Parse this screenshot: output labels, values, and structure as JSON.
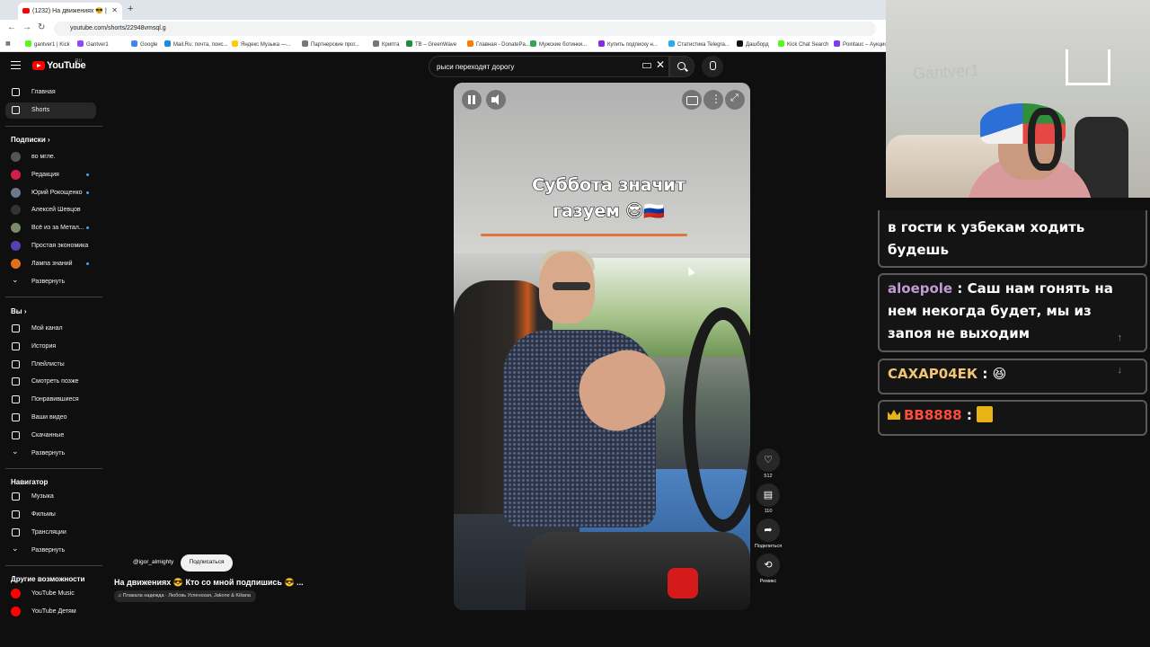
{
  "browser": {
    "tab_title": "(1232) На движениях 😎 |",
    "url": "youtube.com/shorts/22948vmsql.g",
    "bookmarks": [
      {
        "label": "gantver1 | Kick",
        "color": "#53fc18"
      },
      {
        "label": "Gantver1",
        "color": "#9146ff"
      },
      {
        "label": "Google",
        "color": "#4285f4"
      },
      {
        "label": "Mail.Ru: почта, поис...",
        "color": "#168de2"
      },
      {
        "label": "Яндекс Музыка —...",
        "color": "#ffcc00"
      },
      {
        "label": "Партнерские прог...",
        "color": "#777777"
      },
      {
        "label": "Крипта",
        "color": "#777777"
      },
      {
        "label": "TB – GreenWave",
        "color": "#1e8e3e"
      },
      {
        "label": "Главная - DonatePa...",
        "color": "#ff7a00"
      },
      {
        "label": "Мужские ботинки...",
        "color": "#32a852"
      },
      {
        "label": "Купить подписку н...",
        "color": "#8a2be2"
      },
      {
        "label": "Статистика Telegra...",
        "color": "#2aabee"
      },
      {
        "label": "Дашборд",
        "color": "#111111"
      },
      {
        "label": "Kick Chat Search",
        "color": "#53fc18"
      },
      {
        "label": "Pointauc – Аукцио...",
        "color": "#7b3ff2"
      }
    ]
  },
  "youtube": {
    "logo_text": "YouTube",
    "logo_region": "RU",
    "search_value": "рыси переходят дорогу"
  },
  "sidebar": {
    "main": [
      {
        "label": "Главная",
        "icon": "home-icon"
      },
      {
        "label": "Shorts",
        "icon": "shorts-icon"
      }
    ],
    "subs_title": "Подписки",
    "subs": [
      {
        "label": "во мгле.",
        "color": "#555555",
        "dot": false
      },
      {
        "label": "Редакция",
        "color": "#d0204a",
        "dot": true
      },
      {
        "label": "Юрий Рокощенко",
        "color": "#6b7a88",
        "dot": true
      },
      {
        "label": "Алексей Шевцов",
        "color": "#333333",
        "dot": false
      },
      {
        "label": "Всё из за Метал...",
        "color": "#7a8a6a",
        "dot": true
      },
      {
        "label": "Простая экономика",
        "color": "#5a3fb0",
        "dot": false
      },
      {
        "label": "Лампа знаний",
        "color": "#e0701a",
        "dot": true
      }
    ],
    "subs_expand": "Развернуть",
    "you_title": "Вы",
    "you": [
      {
        "label": "Мой канал",
        "icon": "my-channel-icon"
      },
      {
        "label": "История",
        "icon": "history-icon"
      },
      {
        "label": "Плейлисты",
        "icon": "playlists-icon"
      },
      {
        "label": "Смотреть позже",
        "icon": "watch-later-icon"
      },
      {
        "label": "Понравившиеся",
        "icon": "liked-icon"
      },
      {
        "label": "Ваши видео",
        "icon": "your-videos-icon"
      },
      {
        "label": "Скачанные",
        "icon": "downloads-icon"
      }
    ],
    "you_expand": "Развернуть",
    "nav_title": "Навигатор",
    "nav": [
      {
        "label": "Музыка",
        "icon": "music-icon"
      },
      {
        "label": "Фильмы",
        "icon": "movies-icon"
      },
      {
        "label": "Трансляции",
        "icon": "live-icon"
      }
    ],
    "nav_expand": "Развернуть",
    "other_title": "Другие возможности",
    "other": [
      {
        "label": "YouTube Music",
        "icon": "youtube-music-icon"
      },
      {
        "label": "YouTube Детям",
        "icon": "youtube-kids-icon"
      }
    ]
  },
  "video": {
    "caption_line1": "Суббота значит",
    "caption_line2": "газуем 😎🇷🇺",
    "channel": "@igor_almighty",
    "subscribe_label": "Подписаться",
    "title": "На движениях 😎 Кто со мной подпишись 😎 ...",
    "music": "♫ Плакала надежда · Любовь Успенская, Jakone & Kiliana"
  },
  "actions": {
    "like_count": "512",
    "comment_count": "110",
    "share_label": "Поделиться",
    "remix_label": "Ремикс"
  },
  "webcam": {
    "wall_text": "Gantver1"
  },
  "chat": {
    "messages": [
      {
        "user": "",
        "text": "в гости к узбекам ходить будешь",
        "user_color": "#ffffff"
      },
      {
        "user": "aloepole",
        "text": "Саш нам гонять на нем некогда будет, мы из запоя не выходим",
        "user_color": "#c39bd3"
      },
      {
        "user": "САХАР04ЕК",
        "text": "😆",
        "user_color": "#f0c674"
      },
      {
        "user": "BB8888",
        "text": "",
        "user_color": "#ff4b3a"
      }
    ]
  }
}
